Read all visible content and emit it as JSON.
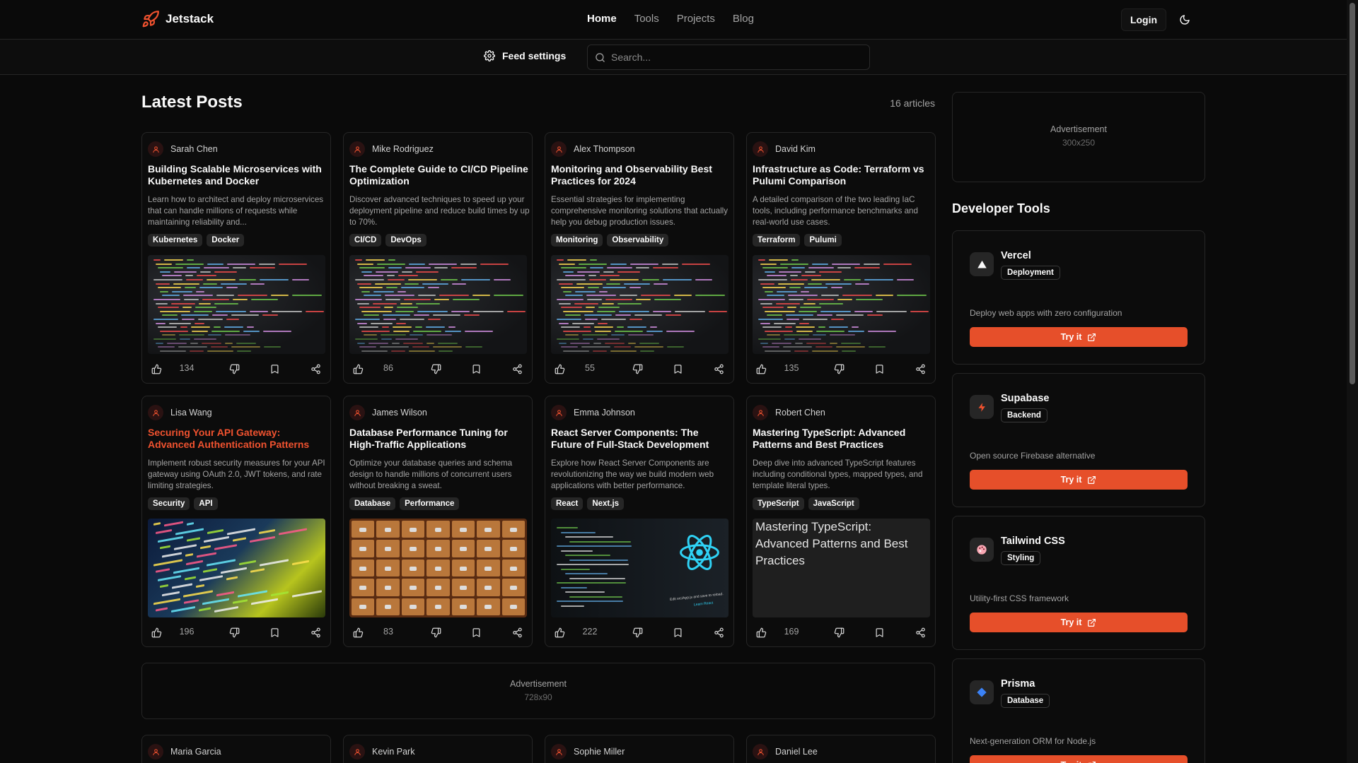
{
  "brand": {
    "name": "Jetstack",
    "logo_icon": "rocket-icon",
    "accent": "#f0522f"
  },
  "nav": {
    "items": [
      "Home",
      "Tools",
      "Projects",
      "Blog"
    ],
    "active": "Home"
  },
  "header": {
    "login_label": "Login",
    "theme_icon": "moon-icon"
  },
  "subbar": {
    "feed_settings_label": "Feed settings",
    "search_placeholder": "Search..."
  },
  "main": {
    "title": "Latest Posts",
    "count": "16 articles"
  },
  "posts": [
    {
      "author": "Sarah Chen",
      "title": "Building Scalable Microservices with Kubernetes and Docker",
      "desc": "Learn how to architect and deploy microservices that can handle millions of requests while maintaining reliability and...",
      "tags": [
        "Kubernetes",
        "Docker"
      ],
      "likes": "134",
      "image": "code-screen"
    },
    {
      "author": "Mike Rodriguez",
      "title": "The Complete Guide to CI/CD Pipeline Optimization",
      "desc": "Discover advanced techniques to speed up your deployment pipeline and reduce build times by up to 70%.",
      "tags": [
        "CI/CD",
        "DevOps"
      ],
      "likes": "86",
      "image": "code-screen"
    },
    {
      "author": "Alex Thompson",
      "title": "Monitoring and Observability Best Practices for 2024",
      "desc": "Essential strategies for implementing comprehensive monitoring solutions that actually help you debug production issues.",
      "tags": [
        "Monitoring",
        "Observability"
      ],
      "likes": "55",
      "image": "code-screen"
    },
    {
      "author": "David Kim",
      "title": "Infrastructure as Code: Terraform vs Pulumi Comparison",
      "desc": "A detailed comparison of the two leading IaC tools, including performance benchmarks and real-world use cases.",
      "tags": [
        "Terraform",
        "Pulumi"
      ],
      "likes": "135",
      "image": "code-screen"
    },
    {
      "author": "Lisa Wang",
      "title": "Securing Your API Gateway: Advanced Authentication Patterns",
      "desc": "Implement robust security measures for your API gateway using OAuth 2.0, JWT tokens, and rate limiting strategies.",
      "tags": [
        "Security",
        "API"
      ],
      "likes": "196",
      "image": "code-colorful",
      "highlight": true
    },
    {
      "author": "James Wilson",
      "title": "Database Performance Tuning for High-Traffic Applications",
      "desc": "Optimize your database queries and schema design to handle millions of concurrent users without breaking a sweat.",
      "tags": [
        "Database",
        "Performance"
      ],
      "likes": "83",
      "image": "card-catalog"
    },
    {
      "author": "Emma Johnson",
      "title": "React Server Components: The Future of Full-Stack Development",
      "desc": "Explore how React Server Components are revolutionizing the way we build modern web applications with better performance.",
      "tags": [
        "React",
        "Next.js"
      ],
      "likes": "222",
      "image": "react-screen",
      "image_caption": "Edit src/App.js and save to reload.",
      "image_link": "Learn React"
    },
    {
      "author": "Robert Chen",
      "title": "Mastering TypeScript: Advanced Patterns and Best Practices",
      "desc": "Deep dive into advanced TypeScript features including conditional types, mapped types, and template literal types.",
      "tags": [
        "TypeScript",
        "JavaScript"
      ],
      "likes": "169",
      "image": "broken",
      "image_alt": "Mastering TypeScript: Advanced Patterns and Best Practices"
    }
  ],
  "ads": {
    "wide": {
      "label": "Advertisement",
      "size": "728x90"
    },
    "side": {
      "label": "Advertisement",
      "size": "300x250"
    }
  },
  "next_row_authors": [
    "Maria Garcia",
    "Kevin Park",
    "Sophie Miller",
    "Daniel Lee"
  ],
  "sidebar": {
    "title": "Developer Tools",
    "tools": [
      {
        "name": "Vercel",
        "badge": "Deployment",
        "desc": "Deploy web apps with zero configuration",
        "cta": "Try it",
        "icon": "triangle-icon"
      },
      {
        "name": "Supabase",
        "badge": "Backend",
        "desc": "Open source Firebase alternative",
        "cta": "Try it",
        "icon": "bolt-icon"
      },
      {
        "name": "Tailwind CSS",
        "badge": "Styling",
        "desc": "Utility-first CSS framework",
        "cta": "Try it",
        "icon": "palette-icon"
      },
      {
        "name": "Prisma",
        "badge": "Database",
        "desc": "Next-generation ORM for Node.js",
        "cta": "Try it",
        "icon": "diamond-icon"
      }
    ]
  }
}
